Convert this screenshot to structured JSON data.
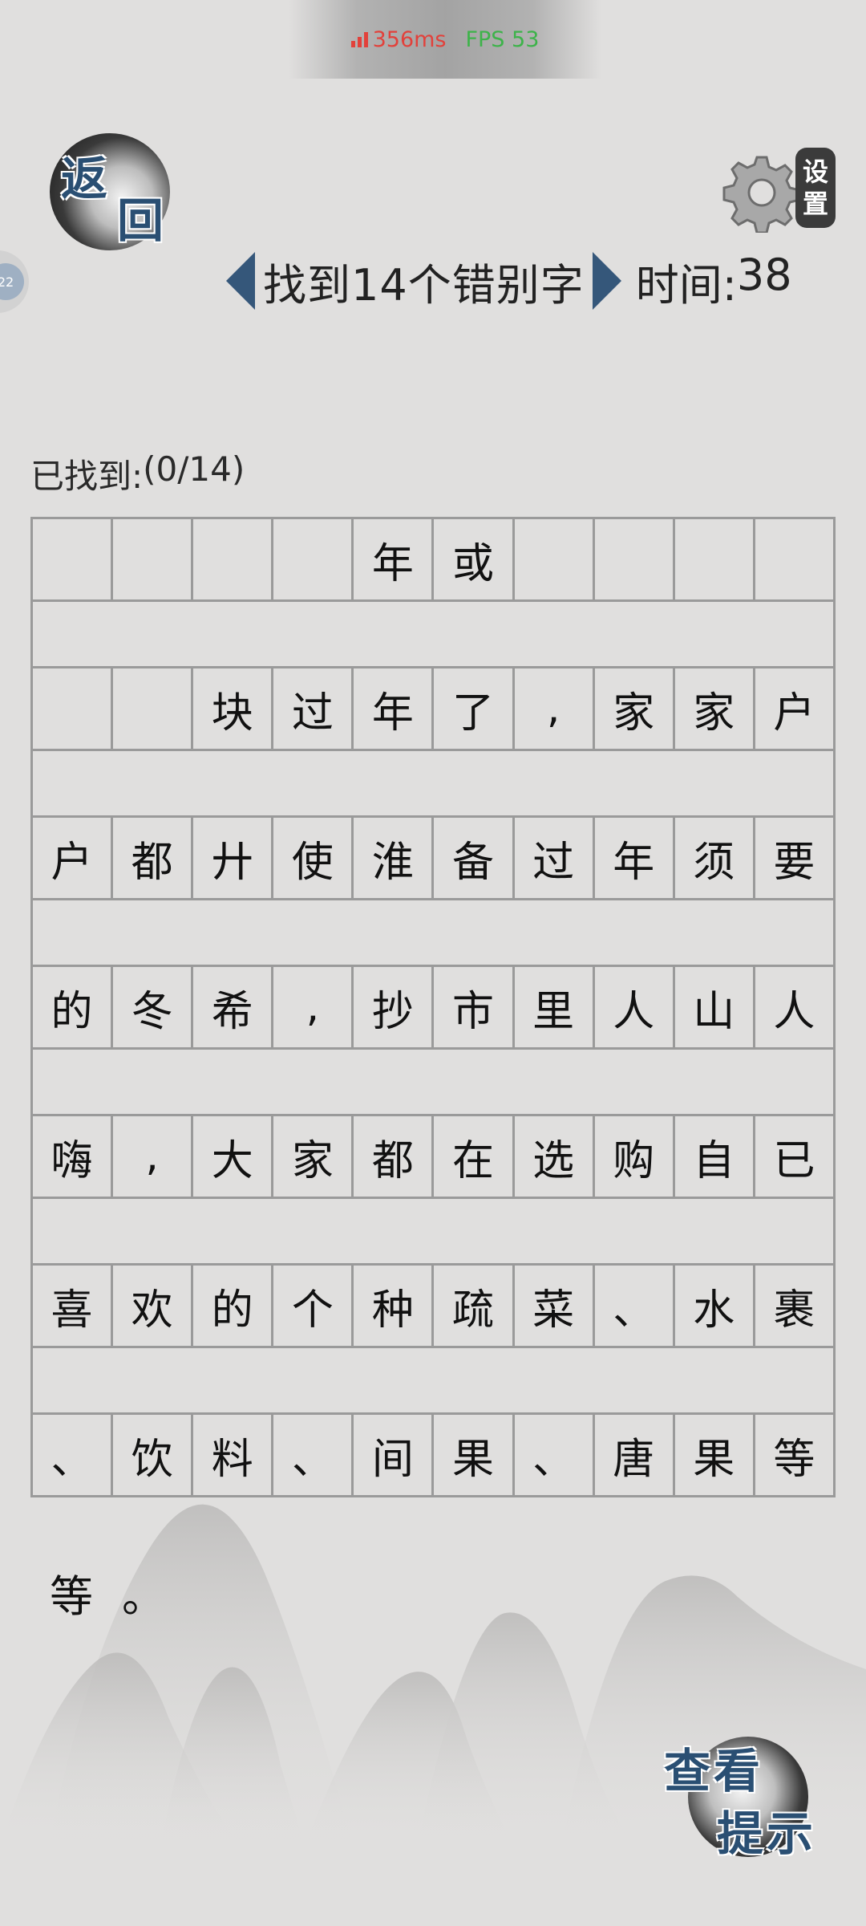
{
  "hud": {
    "ping": "356ms",
    "fps": "FPS 53",
    "ping_color": "#e2413b",
    "fps_color": "#3db34a"
  },
  "back_button": {
    "chars": [
      "返",
      "回"
    ]
  },
  "settings_button": {
    "chars": [
      "设",
      "置"
    ],
    "icon": "gear-icon"
  },
  "side_tab": {
    "label": "22"
  },
  "level": {
    "title": "找到14个错别字",
    "timer_label": "时间:",
    "timer_value": "38"
  },
  "progress": {
    "label": "已找到:",
    "value": "(0/14)"
  },
  "grid": {
    "rows": [
      [
        "",
        "",
        "",
        "",
        "年",
        "或",
        "",
        "",
        "",
        ""
      ],
      [
        "",
        "",
        "块",
        "过",
        "年",
        "了",
        ",",
        "家",
        "家",
        "户"
      ],
      [
        "户",
        "都",
        "廾",
        "使",
        "淮",
        "备",
        "过",
        "年",
        "须",
        "要"
      ],
      [
        "的",
        "冬",
        "希",
        ",",
        "抄",
        "市",
        "里",
        "人",
        "山",
        "人"
      ],
      [
        "嗨",
        ",",
        "大",
        "家",
        "都",
        "在",
        "选",
        "购",
        "自",
        "已"
      ],
      [
        "喜",
        "欢",
        "的",
        "个",
        "种",
        "疏",
        "菜",
        "、",
        "水",
        "裹"
      ],
      [
        "、",
        "饮",
        "料",
        "、",
        "间",
        "果",
        "、",
        "唐",
        "果",
        "等"
      ]
    ],
    "tail": [
      "等",
      "。"
    ]
  },
  "hint_button": {
    "chars": [
      "查",
      "看",
      "提",
      "示"
    ]
  },
  "colors": {
    "background": "#e0dfde",
    "accent_blue": "#2a4f73",
    "arrow": "#35577a",
    "grid_line": "#9a9a9a"
  }
}
